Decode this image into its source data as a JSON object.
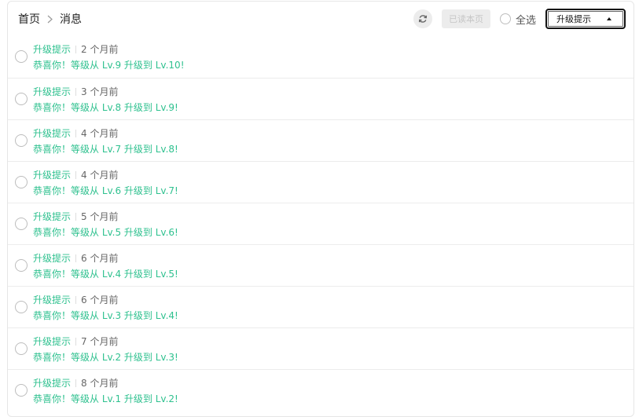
{
  "breadcrumb": {
    "home": "首页",
    "current": "消息"
  },
  "toolbar": {
    "mark_read_label": "已读本页",
    "select_all_label": "全选",
    "filter_value": "升级提示"
  },
  "colors": {
    "accent": "#2fc18f",
    "muted": "#ececec"
  },
  "messages": [
    {
      "type": "升级提示",
      "time": "2 个月前",
      "text": "恭喜你！等级从 Lv.9 升级到 Lv.10!"
    },
    {
      "type": "升级提示",
      "time": "3 个月前",
      "text": "恭喜你！等级从 Lv.8 升级到 Lv.9!"
    },
    {
      "type": "升级提示",
      "time": "4 个月前",
      "text": "恭喜你！等级从 Lv.7 升级到 Lv.8!"
    },
    {
      "type": "升级提示",
      "time": "4 个月前",
      "text": "恭喜你！等级从 Lv.6 升级到 Lv.7!"
    },
    {
      "type": "升级提示",
      "time": "5 个月前",
      "text": "恭喜你！等级从 Lv.5 升级到 Lv.6!"
    },
    {
      "type": "升级提示",
      "time": "6 个月前",
      "text": "恭喜你！等级从 Lv.4 升级到 Lv.5!"
    },
    {
      "type": "升级提示",
      "time": "6 个月前",
      "text": "恭喜你！等级从 Lv.3 升级到 Lv.4!"
    },
    {
      "type": "升级提示",
      "time": "7 个月前",
      "text": "恭喜你！等级从 Lv.2 升级到 Lv.3!"
    },
    {
      "type": "升级提示",
      "time": "8 个月前",
      "text": "恭喜你！等级从 Lv.1 升级到 Lv.2!"
    }
  ]
}
